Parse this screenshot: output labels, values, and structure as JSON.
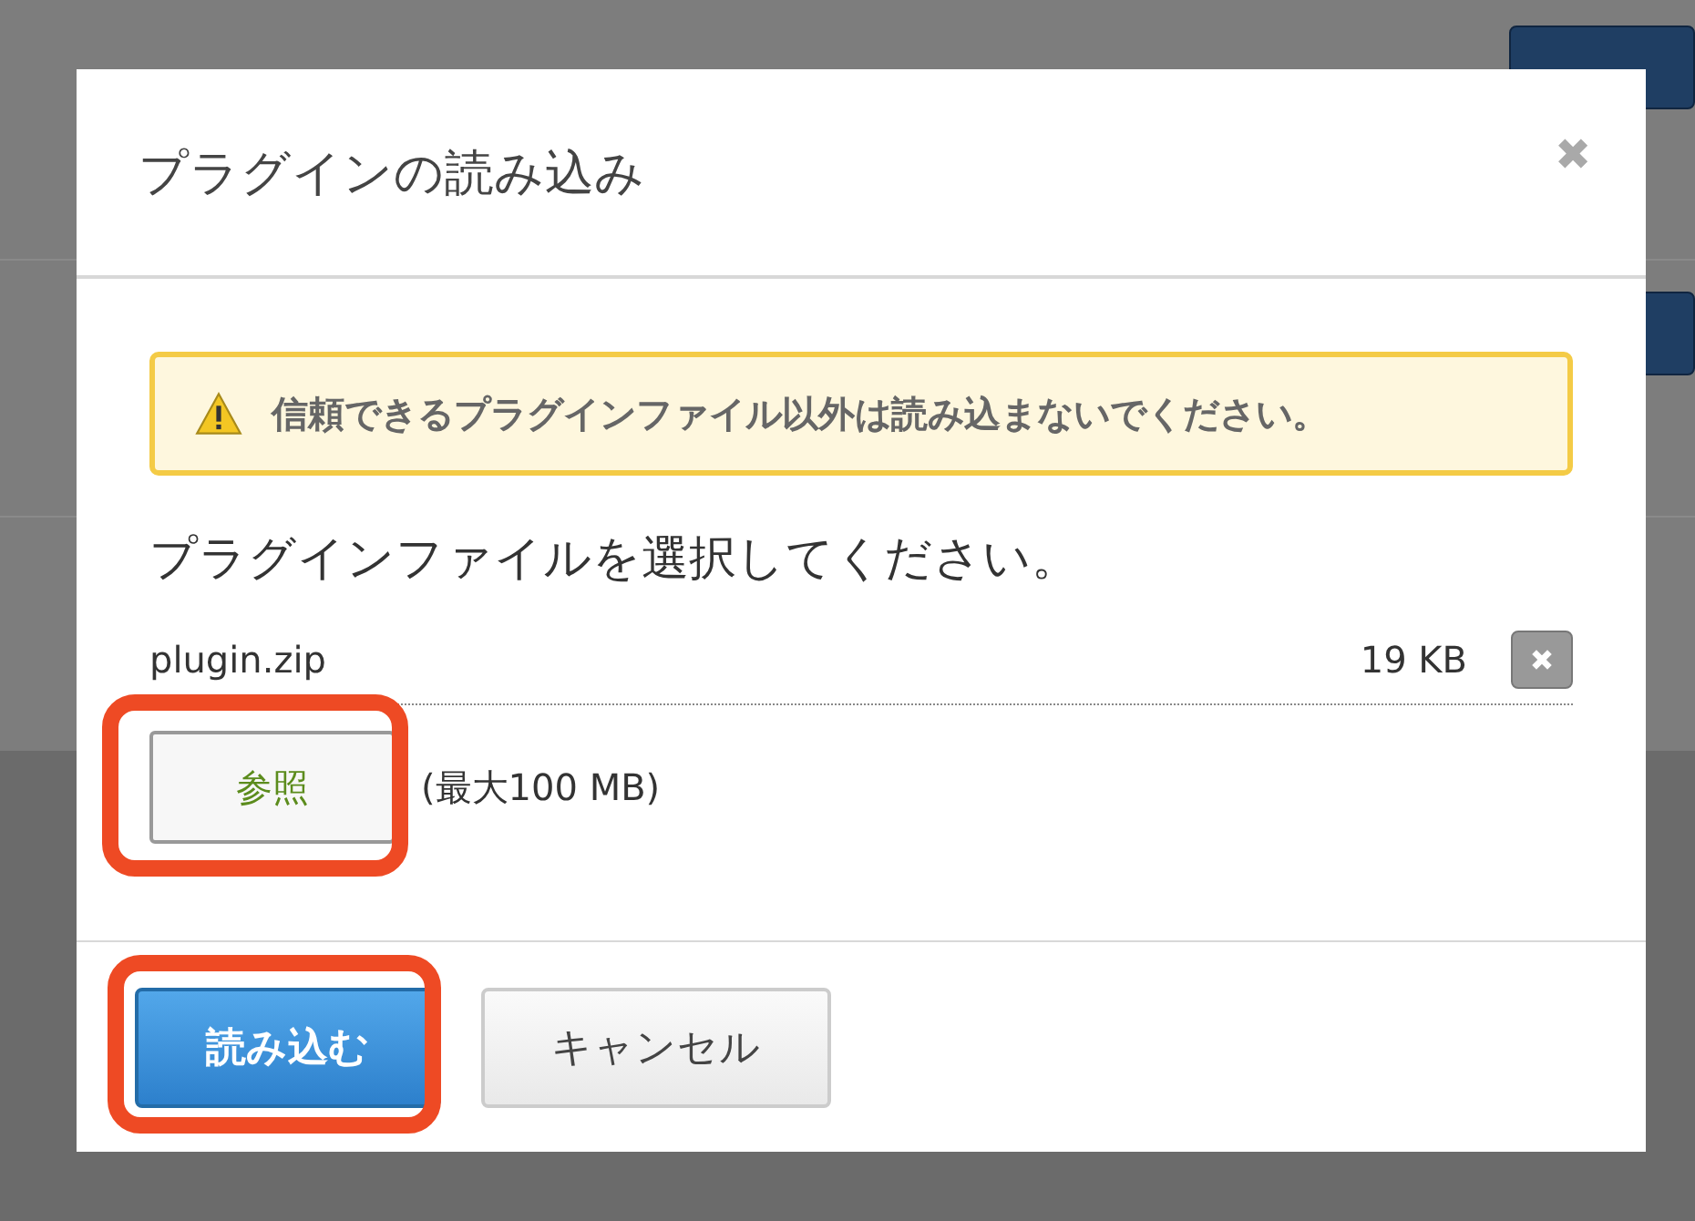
{
  "dialog": {
    "title": "プラグインの読み込み",
    "close": "✖",
    "warning": "信頼できるプラグインファイル以外は読み込まないでください。",
    "prompt": "プラグインファイルを選択してください。",
    "file": {
      "name": "plugin.zip",
      "size": "19 KB"
    },
    "browse": "参照",
    "limit": "(最大100 MB)",
    "buttons": [
      {
        "label": "読み込む",
        "kind": "primary",
        "highlighted": true
      },
      {
        "label": "キャンセル",
        "kind": "secondary",
        "highlighted": false
      }
    ],
    "browse_highlighted": true
  }
}
